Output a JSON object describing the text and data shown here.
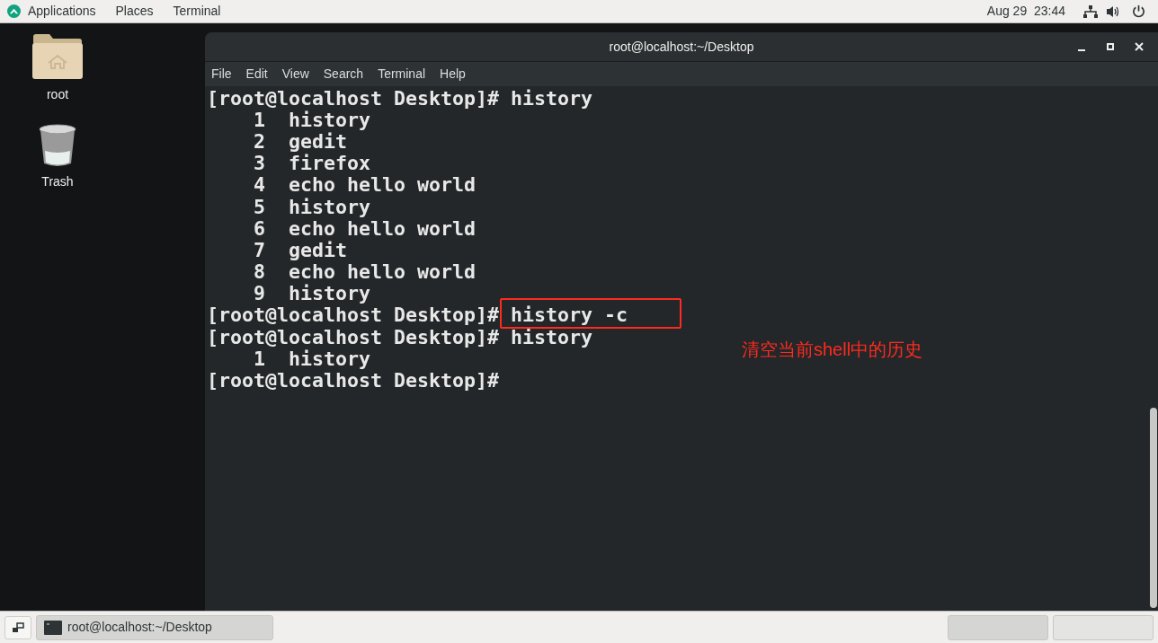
{
  "top_bar": {
    "menus": [
      "Applications",
      "Places",
      "Terminal"
    ],
    "clock": "Aug 29  23:44"
  },
  "desktop_icons": [
    {
      "label": "root",
      "kind": "home-folder"
    },
    {
      "label": "Trash",
      "kind": "trash"
    }
  ],
  "terminal": {
    "title": "root@localhost:~/Desktop",
    "menu": [
      "File",
      "Edit",
      "View",
      "Search",
      "Terminal",
      "Help"
    ],
    "lines": [
      {
        "kind": "prompt",
        "prompt": "[root@localhost Desktop]#",
        "command": "history"
      },
      {
        "kind": "output",
        "number": "1",
        "text": "history"
      },
      {
        "kind": "output",
        "number": "2",
        "text": "gedit"
      },
      {
        "kind": "output",
        "number": "3",
        "text": "firefox"
      },
      {
        "kind": "output",
        "number": "4",
        "text": "echo hello world"
      },
      {
        "kind": "output",
        "number": "5",
        "text": "history"
      },
      {
        "kind": "output",
        "number": "6",
        "text": "echo hello world"
      },
      {
        "kind": "output",
        "number": "7",
        "text": "gedit"
      },
      {
        "kind": "output",
        "number": "8",
        "text": "echo hello world"
      },
      {
        "kind": "output",
        "number": "9",
        "text": "history"
      },
      {
        "kind": "prompt",
        "prompt": "[root@localhost Desktop]#",
        "command": "history -c"
      },
      {
        "kind": "prompt",
        "prompt": "[root@localhost Desktop]#",
        "command": "history"
      },
      {
        "kind": "output",
        "number": "1",
        "text": "history"
      },
      {
        "kind": "prompt",
        "prompt": "[root@localhost Desktop]#"
      }
    ]
  },
  "annotation": {
    "text": "清空当前shell中的历史"
  },
  "taskbar": {
    "window_label": "root@localhost:~/Desktop"
  }
}
